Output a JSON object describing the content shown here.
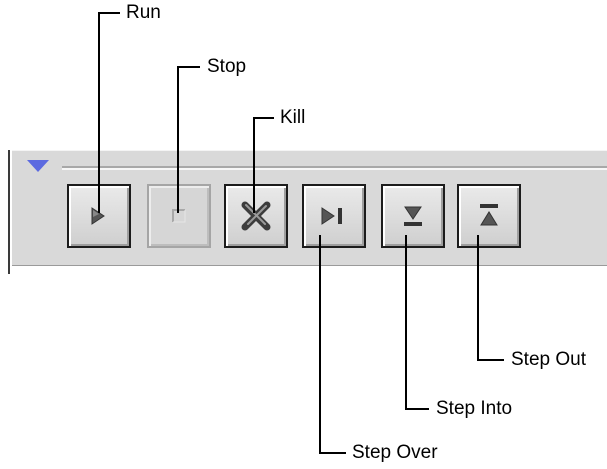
{
  "callouts": {
    "run": "Run",
    "stop": "Stop",
    "kill": "Kill",
    "step_over": "Step Over",
    "step_into": "Step Into",
    "step_out": "Step Out"
  },
  "toolbar": {
    "collapse_arrow_color": "#5c6ae0",
    "buttons": [
      {
        "name": "run",
        "icon": "play-icon",
        "enabled": true
      },
      {
        "name": "stop",
        "icon": "stop-icon",
        "enabled": false
      },
      {
        "name": "kill",
        "icon": "kill-x-icon",
        "enabled": true
      },
      {
        "name": "step-over",
        "icon": "step-over-icon",
        "enabled": true
      },
      {
        "name": "step-into",
        "icon": "step-into-icon",
        "enabled": true
      },
      {
        "name": "step-out",
        "icon": "step-out-icon",
        "enabled": true
      }
    ]
  }
}
